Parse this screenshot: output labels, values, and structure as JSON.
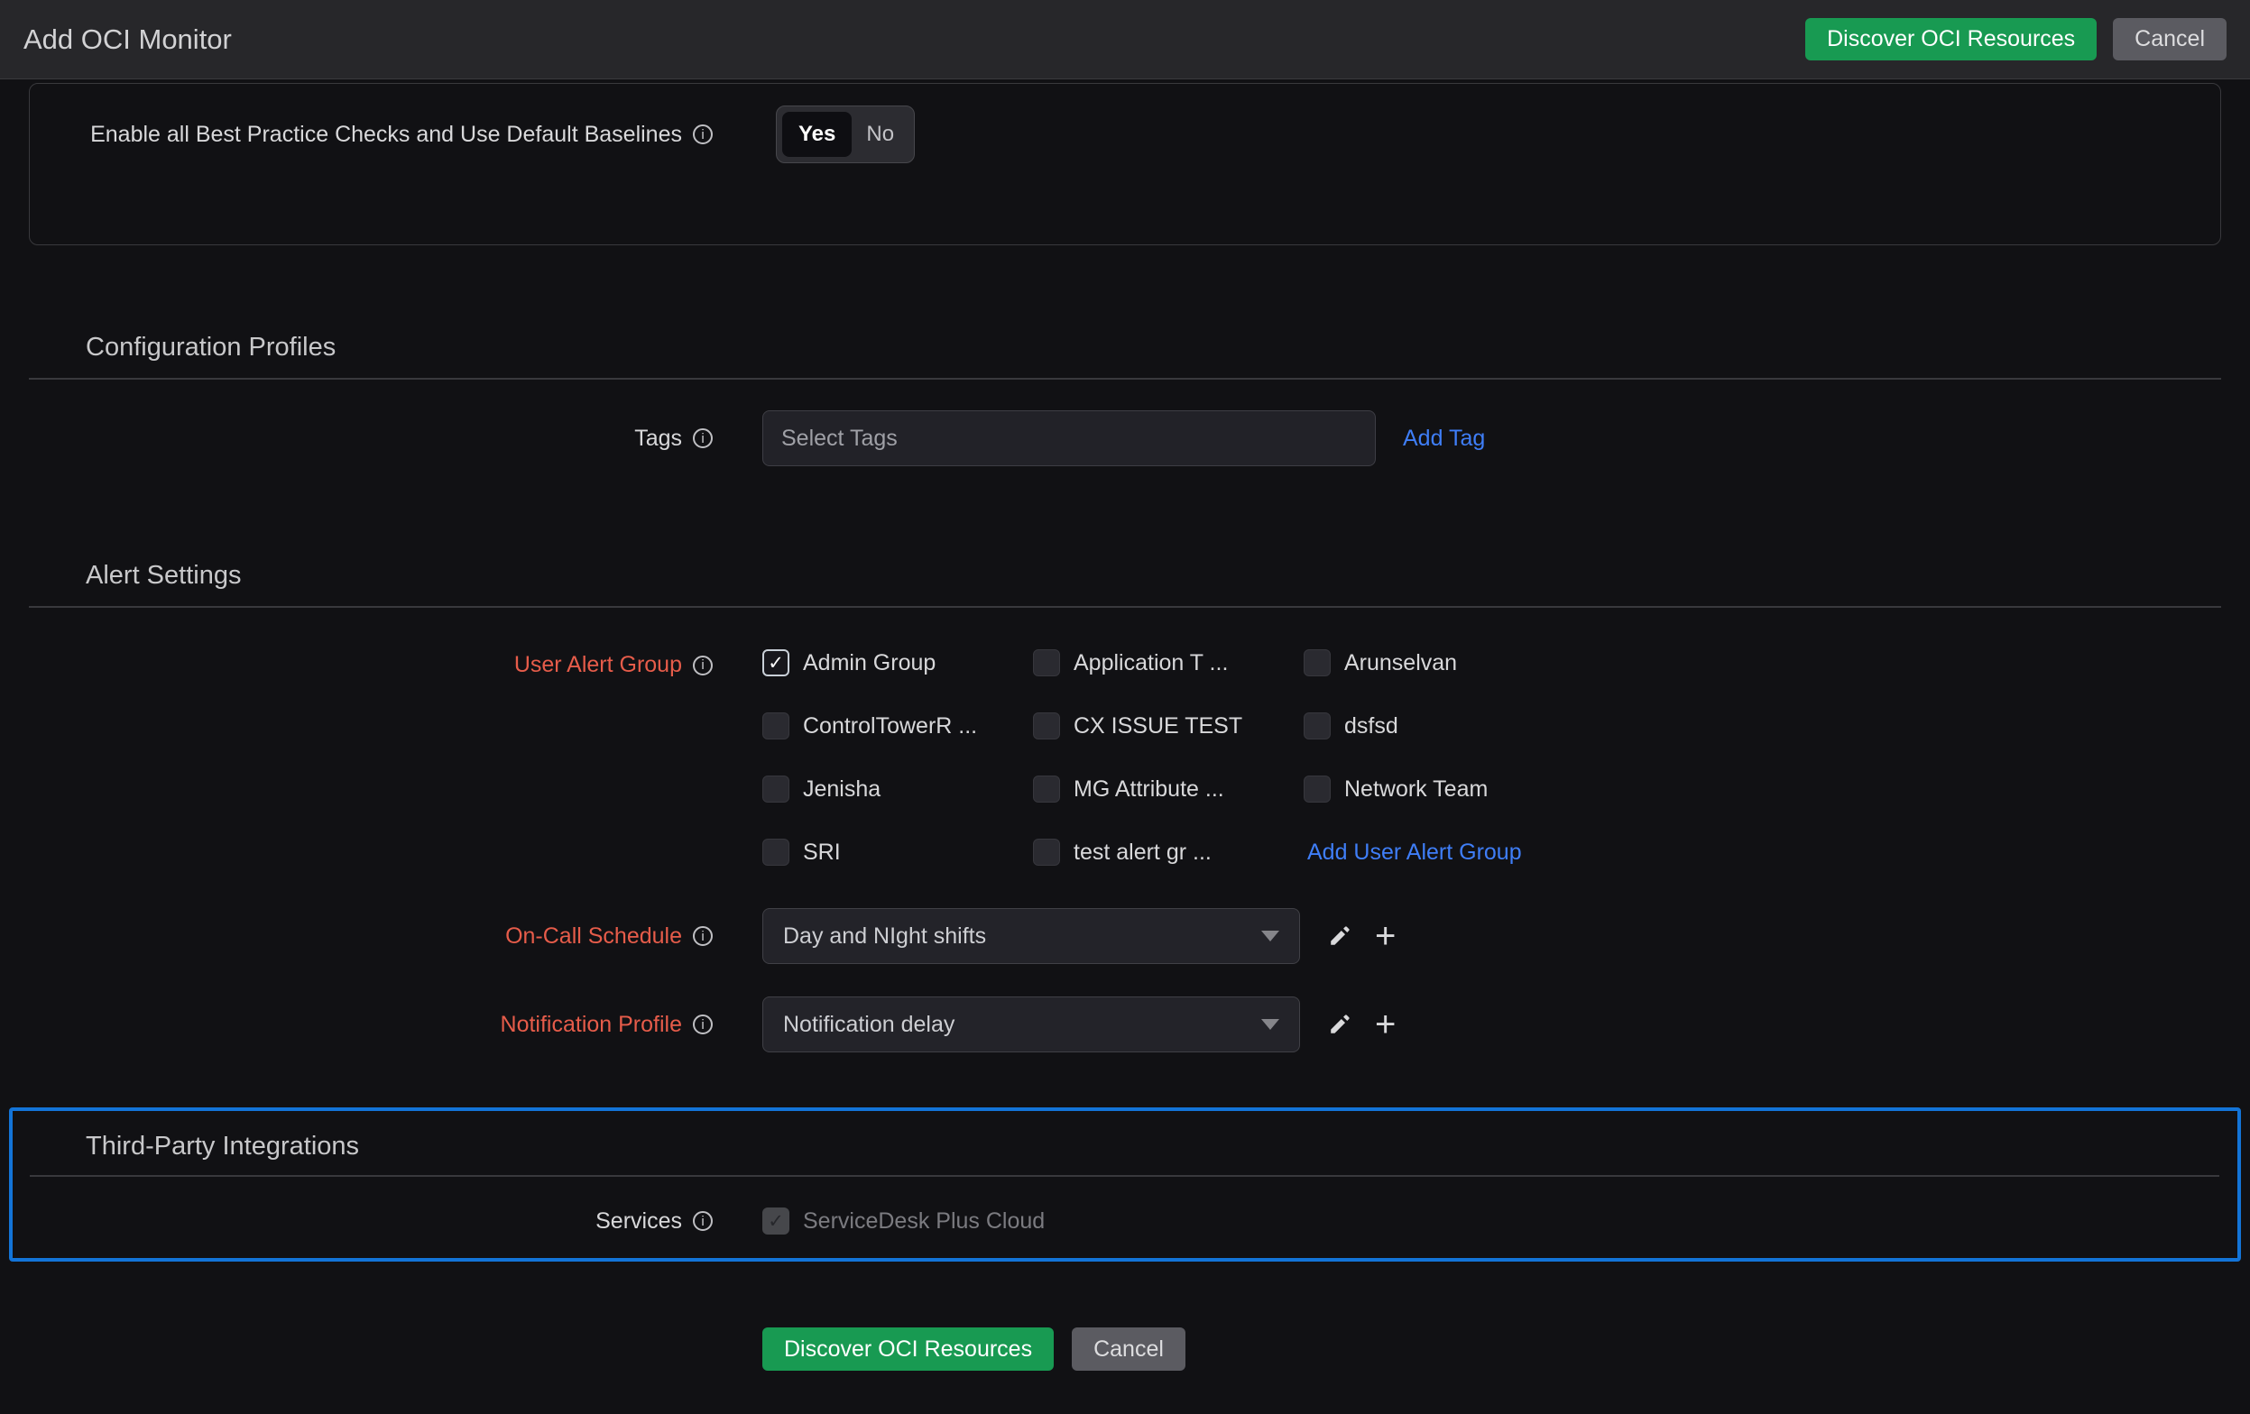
{
  "header": {
    "title": "Add OCI Monitor",
    "buttons": {
      "discover": "Discover OCI Resources",
      "cancel": "Cancel"
    }
  },
  "best_practice": {
    "label": "Enable all Best Practice Checks and Use Default Baselines",
    "toggle": {
      "yes_label": "Yes",
      "no_label": "No",
      "selected": "Yes"
    }
  },
  "configuration_profiles": {
    "heading": "Configuration Profiles",
    "tags_label": "Tags",
    "tags_placeholder": "Select Tags",
    "add_tag_link": "Add Tag"
  },
  "alert_settings": {
    "heading": "Alert Settings",
    "user_alert_group_label": "User Alert Group",
    "groups": [
      {
        "label": "Admin Group",
        "checked": true
      },
      {
        "label": "Application T ...",
        "checked": false
      },
      {
        "label": "Arunselvan",
        "checked": false
      },
      {
        "label": "ControlTowerR ...",
        "checked": false
      },
      {
        "label": "CX ISSUE TEST",
        "checked": false
      },
      {
        "label": "dsfsd",
        "checked": false
      },
      {
        "label": "Jenisha",
        "checked": false
      },
      {
        "label": "MG Attribute ...",
        "checked": false
      },
      {
        "label": "Network Team",
        "checked": false
      },
      {
        "label": "SRI",
        "checked": false
      },
      {
        "label": "test alert gr ...",
        "checked": false
      }
    ],
    "add_user_alert_group_link": "Add User Alert Group",
    "on_call_label": "On-Call Schedule",
    "on_call_value": "Day and NIght shifts",
    "notification_label": "Notification Profile",
    "notification_value": "Notification delay"
  },
  "third_party": {
    "heading": "Third-Party Integrations",
    "services_label": "Services",
    "service_option": {
      "label": "ServiceDesk Plus Cloud",
      "checked": true,
      "disabled": true
    }
  },
  "footer": {
    "discover": "Discover OCI Resources",
    "cancel": "Cancel"
  },
  "colors": {
    "green": "#189a52",
    "label_red": "#e65c4a",
    "link_blue": "#3f7ef8",
    "highlight_border": "#1374d8"
  },
  "glyphs": {
    "check": "✓",
    "plus": "+",
    "info": "i"
  }
}
